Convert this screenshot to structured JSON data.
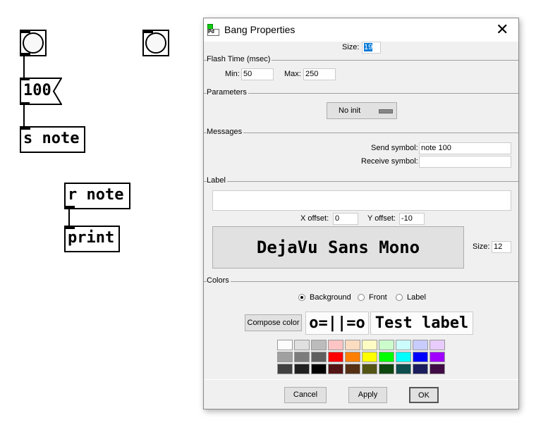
{
  "canvas": {
    "message_box": "100",
    "send_object": "s note",
    "receive_object": "r note",
    "print_object": "print"
  },
  "dialog": {
    "title": "Bang Properties",
    "size_label": "Size:",
    "size_value": "19",
    "flash_time": {
      "header": "Flash Time (msec)",
      "min_label": "Min:",
      "min_value": "50",
      "max_label": "Max:",
      "max_value": "250"
    },
    "parameters": {
      "header": "Parameters",
      "init_option": "No init"
    },
    "messages": {
      "header": "Messages",
      "send_label": "Send symbol:",
      "send_value": "note 100",
      "receive_label": "Receive symbol:",
      "receive_value": ""
    },
    "label": {
      "header": "Label",
      "value": "",
      "x_offset_label": "X offset:",
      "x_offset_value": "0",
      "y_offset_label": "Y offset:",
      "y_offset_value": "-10",
      "font_button": "DejaVu Sans Mono",
      "size_label": "Size:",
      "size_value": "12"
    },
    "colors": {
      "header": "Colors",
      "radios": [
        {
          "label": "Background",
          "checked": true
        },
        {
          "label": "Front",
          "checked": false
        },
        {
          "label": "Label",
          "checked": false
        }
      ],
      "compose_button": "Compose color",
      "preview_bang": "o=||=o",
      "preview_label": "Test label",
      "palette": [
        [
          "#fcfcfc",
          "#e0e0e0",
          "#bcbcbc",
          "#fcc4c4",
          "#fcdcc0",
          "#fcfcc4",
          "#ccfccc",
          "#ccfcfc",
          "#c8ccfc",
          "#e8ccfc"
        ],
        [
          "#a0a0a0",
          "#7c7c7c",
          "#606060",
          "#ff0000",
          "#ff8000",
          "#ffff00",
          "#00ff00",
          "#00ffff",
          "#0000ff",
          "#a000ff"
        ],
        [
          "#404040",
          "#202020",
          "#000000",
          "#551414",
          "#553014",
          "#535514",
          "#0f4710",
          "#0e4e4e",
          "#1b1d5e",
          "#410b45"
        ]
      ]
    },
    "buttons": {
      "cancel": "Cancel",
      "apply": "Apply",
      "ok": "OK"
    }
  }
}
